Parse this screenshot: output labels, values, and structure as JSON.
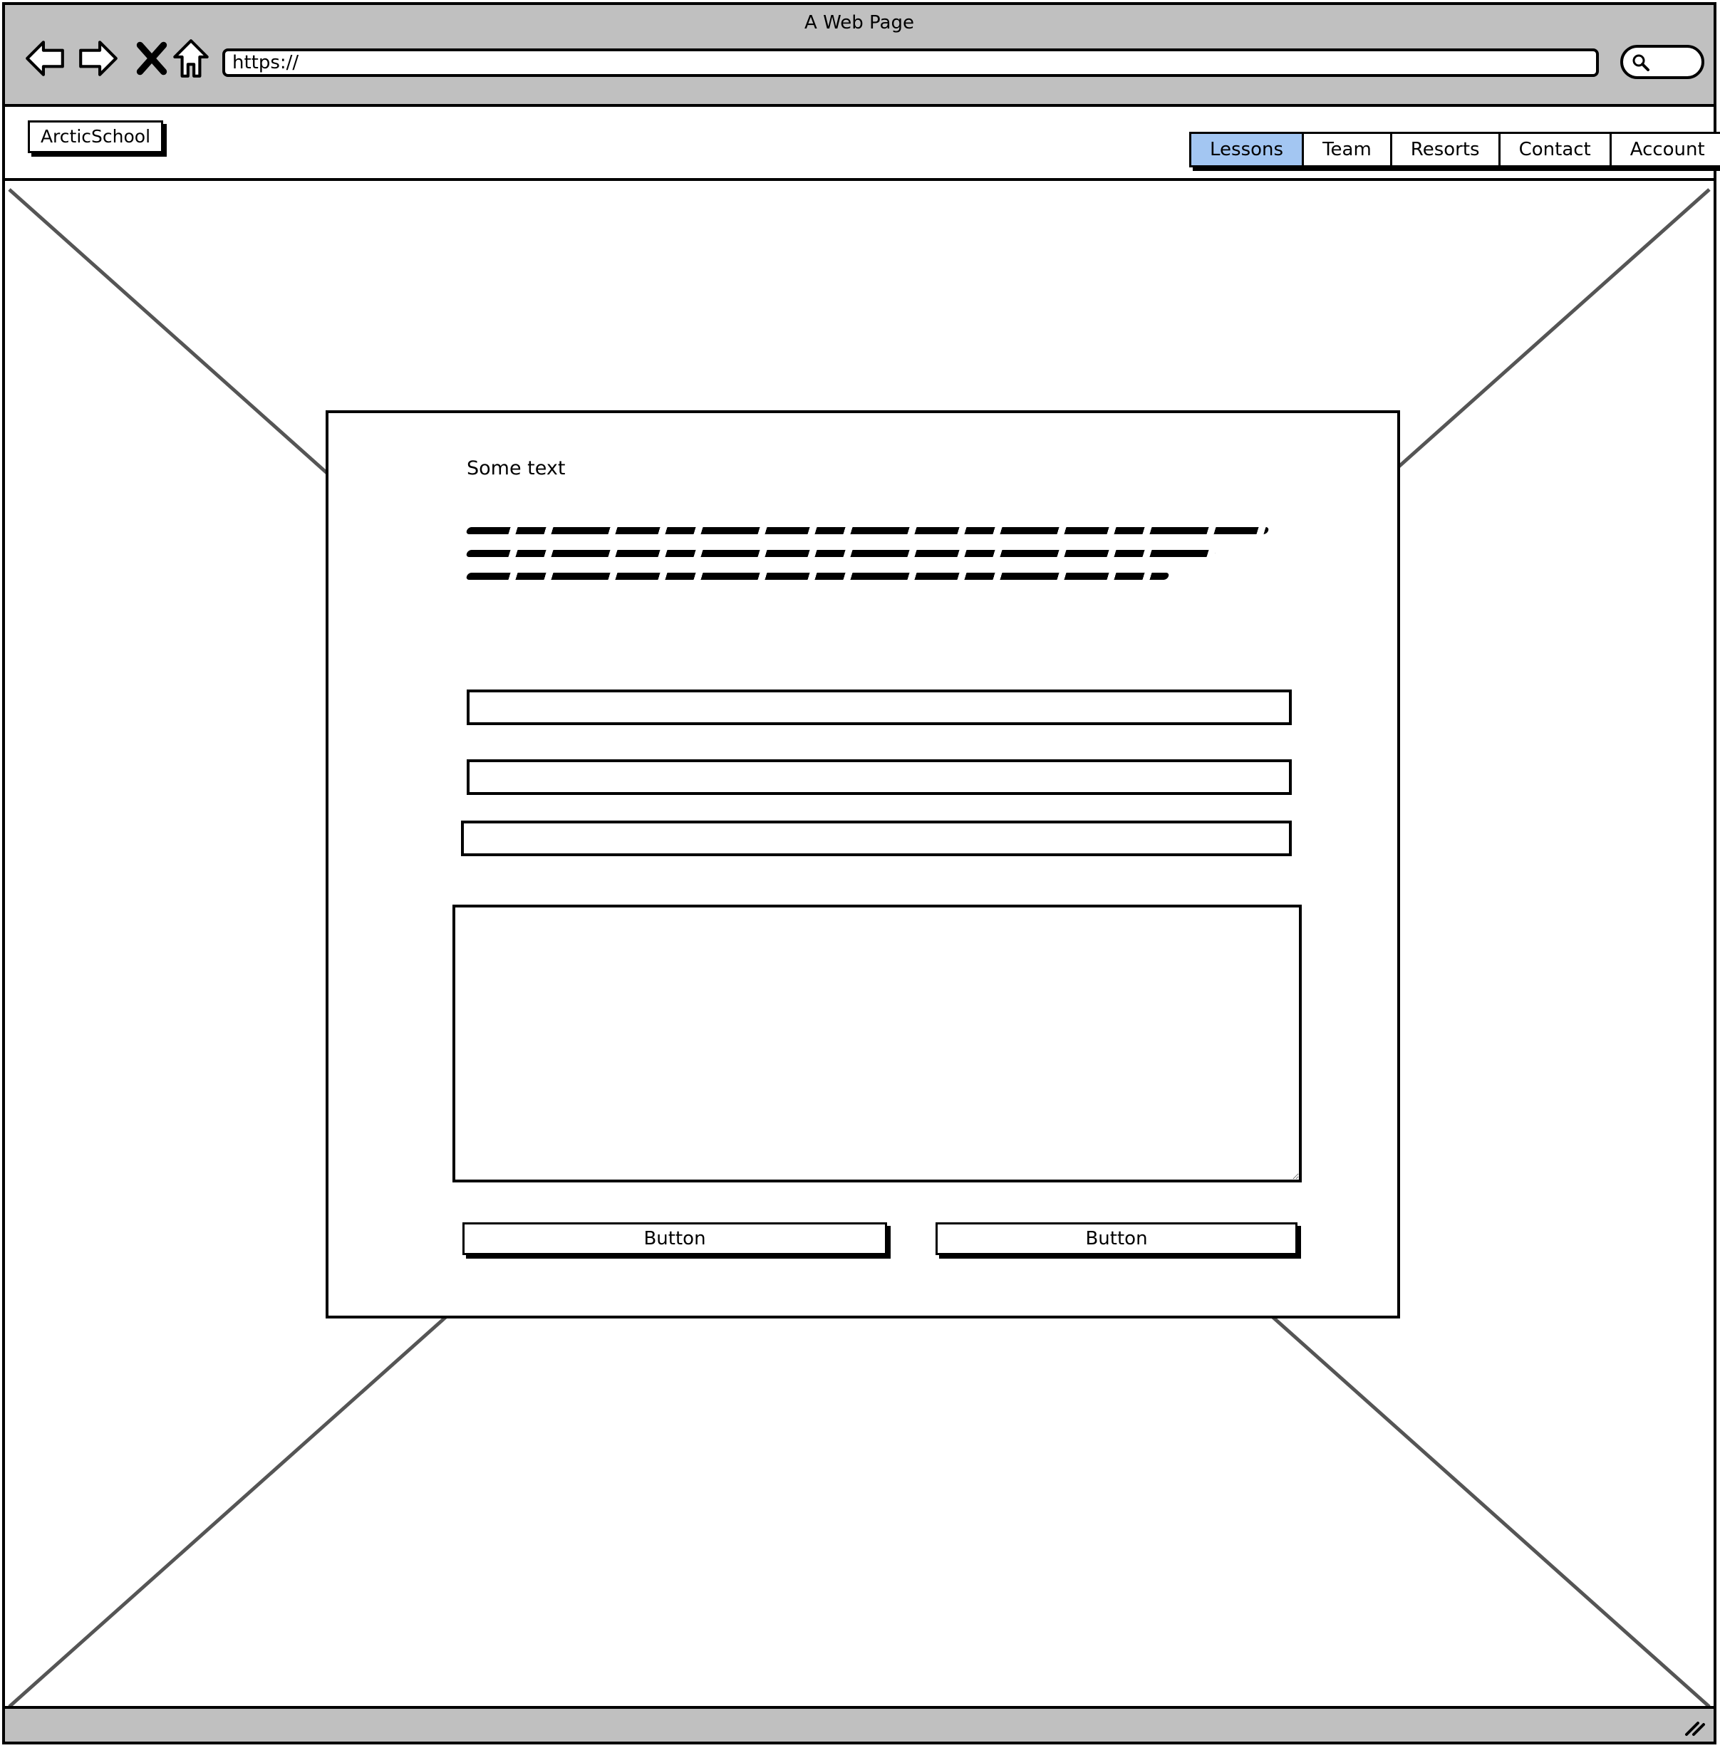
{
  "window": {
    "title": "A Web Page"
  },
  "browser": {
    "url": "https://",
    "icons": [
      "back-arrow-icon",
      "forward-arrow-icon",
      "close-x-icon",
      "home-icon",
      "search-icon"
    ]
  },
  "header": {
    "logo": "ArcticSchool",
    "nav": [
      {
        "label": "Lessons",
        "active": true
      },
      {
        "label": "Team",
        "active": false
      },
      {
        "label": "Resorts",
        "active": false
      },
      {
        "label": "Contact",
        "active": false
      },
      {
        "label": "Account",
        "active": false
      }
    ]
  },
  "form": {
    "heading": "Some text",
    "inputs": [
      {
        "value": ""
      },
      {
        "value": ""
      },
      {
        "value": ""
      }
    ],
    "textarea_value": "",
    "buttons": [
      {
        "label": "Button"
      },
      {
        "label": "Button"
      }
    ]
  },
  "colors": {
    "chrome": "#c0c0c0",
    "active_tab": "#a3c6f2",
    "placeholder_lines": "#555555"
  }
}
